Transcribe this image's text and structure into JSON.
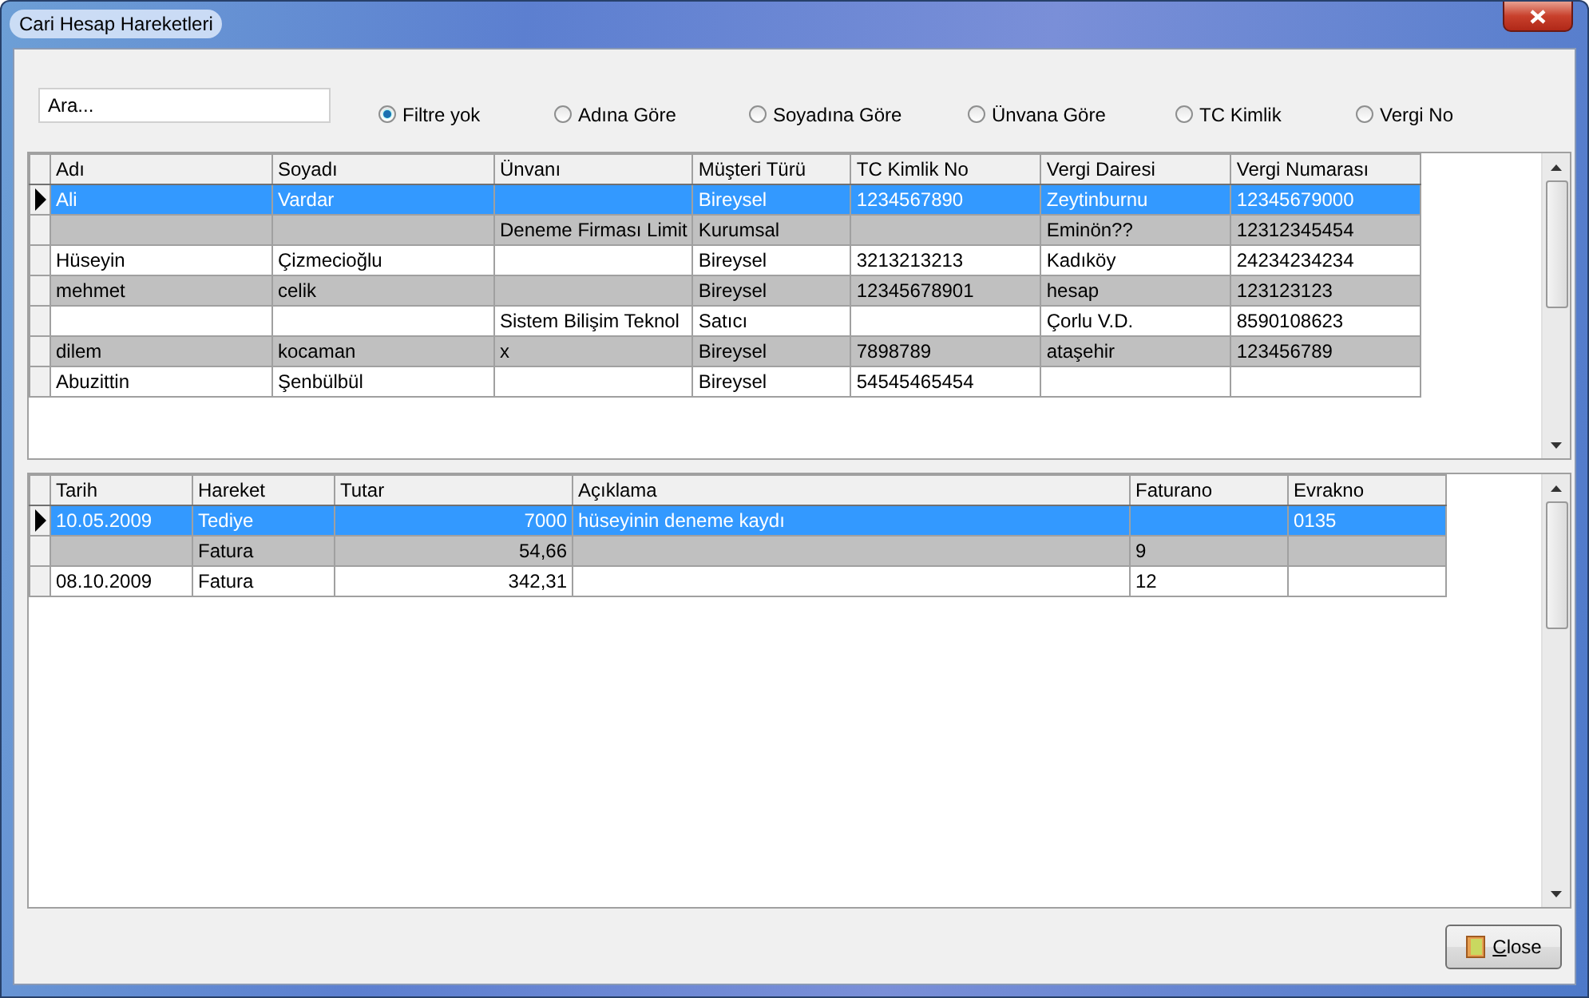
{
  "window": {
    "title": "Cari Hesap Hareketleri"
  },
  "search": {
    "placeholder": "Ara..."
  },
  "filters": [
    {
      "label": "Filtre yok",
      "selected": true
    },
    {
      "label": "Adına Göre",
      "selected": false
    },
    {
      "label": "Soyadına Göre",
      "selected": false
    },
    {
      "label": "Ünvana Göre",
      "selected": false
    },
    {
      "label": "TC Kimlik",
      "selected": false
    },
    {
      "label": "Vergi No",
      "selected": false
    }
  ],
  "accounts_table": {
    "columns": [
      {
        "label": "Adı"
      },
      {
        "label": "Soyadı"
      },
      {
        "label": "Ünvanı"
      },
      {
        "label": "Müşteri Türü"
      },
      {
        "label": "TC Kimlik No"
      },
      {
        "label": "Vergi Dairesi"
      },
      {
        "label": "Vergi Numarası"
      }
    ],
    "rows": [
      {
        "selected": true,
        "cells": [
          "Ali",
          "Vardar",
          "",
          "Bireysel",
          "1234567890",
          "Zeytinburnu",
          "12345679000"
        ]
      },
      {
        "selected": false,
        "cells": [
          "",
          "",
          "Deneme Firması Limit",
          "Kurumsal",
          "",
          "Eminön??",
          "12312345454"
        ]
      },
      {
        "selected": false,
        "cells": [
          "Hüseyin",
          "Çizmecioğlu",
          "",
          "Bireysel",
          "3213213213",
          "Kadıköy",
          "24234234234"
        ]
      },
      {
        "selected": false,
        "cells": [
          "mehmet",
          "celik",
          "",
          "Bireysel",
          "12345678901",
          "hesap",
          "123123123"
        ]
      },
      {
        "selected": false,
        "cells": [
          "",
          "",
          "Sistem Bilişim Teknol",
          "Satıcı",
          "",
          "Çorlu V.D.",
          "8590108623"
        ]
      },
      {
        "selected": false,
        "cells": [
          "dilem",
          "kocaman",
          "x",
          "Bireysel",
          "7898789",
          "ataşehir",
          "123456789"
        ]
      },
      {
        "selected": false,
        "cells": [
          "Abuzittin",
          "Şenbülbül",
          "",
          "Bireysel",
          "54545465454",
          "",
          ""
        ]
      }
    ]
  },
  "transactions_table": {
    "columns": [
      {
        "label": "Tarih"
      },
      {
        "label": "Hareket"
      },
      {
        "label": "Tutar"
      },
      {
        "label": "Açıklama"
      },
      {
        "label": "Faturano"
      },
      {
        "label": "Evrakno"
      }
    ],
    "rows": [
      {
        "selected": true,
        "cells": [
          "10.05.2009",
          "Tediye",
          "7000",
          "hüseyinin deneme kaydı",
          "",
          "0135"
        ]
      },
      {
        "selected": false,
        "cells": [
          "",
          "Fatura",
          "54,66",
          "",
          "9",
          ""
        ]
      },
      {
        "selected": false,
        "cells": [
          "08.10.2009",
          "Fatura",
          "342,31",
          "",
          "12",
          ""
        ]
      }
    ]
  },
  "buttons": [
    {
      "label": "Close"
    }
  ]
}
